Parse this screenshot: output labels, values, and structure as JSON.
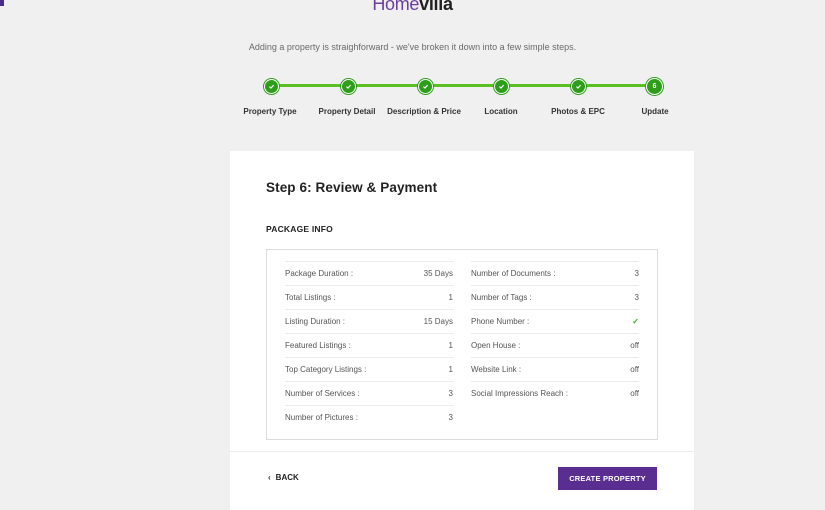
{
  "brand": {
    "logo_home": "Home",
    "logo_villa": "villa",
    "accent_color": "#5a2d91",
    "success_color": "#3aa51f"
  },
  "tagline": "Adding a property is straighforward - we've broken it down into a few simple steps.",
  "steps": [
    {
      "label": "Property Type",
      "status": "complete",
      "icon": "check-icon"
    },
    {
      "label": "Property Detail",
      "status": "complete",
      "icon": "check-icon"
    },
    {
      "label": "Description & Price",
      "status": "complete",
      "icon": "check-icon"
    },
    {
      "label": "Location",
      "status": "complete",
      "icon": "check-icon"
    },
    {
      "label": "Photos & EPC",
      "status": "complete",
      "icon": "check-icon"
    },
    {
      "label": "Update",
      "status": "current",
      "number": "6"
    }
  ],
  "card": {
    "title": "Step 6: Review & Payment",
    "section_title": "PACKAGE INFO"
  },
  "package_info": {
    "left": [
      {
        "label": "Package Duration :",
        "value": "35 Days"
      },
      {
        "label": "Total Listings :",
        "value": "1"
      },
      {
        "label": "Listing Duration :",
        "value": "15 Days"
      },
      {
        "label": "Featured Listings :",
        "value": "1"
      },
      {
        "label": "Top Category Listings :",
        "value": "1"
      },
      {
        "label": "Number of Services :",
        "value": "3"
      },
      {
        "label": "Number of Pictures :",
        "value": "3"
      }
    ],
    "right": [
      {
        "label": "Number of Documents :",
        "value": "3"
      },
      {
        "label": "Number of Tags :",
        "value": "3"
      },
      {
        "label": "Phone Number :",
        "value": "✓",
        "icon": "check-icon"
      },
      {
        "label": "Open House :",
        "value": "off"
      },
      {
        "label": "Website Link :",
        "value": "off"
      },
      {
        "label": "Social Impressions Reach :",
        "value": "off"
      }
    ]
  },
  "actions": {
    "back_label": "BACK",
    "create_label": "CREATE PROPERTY"
  }
}
